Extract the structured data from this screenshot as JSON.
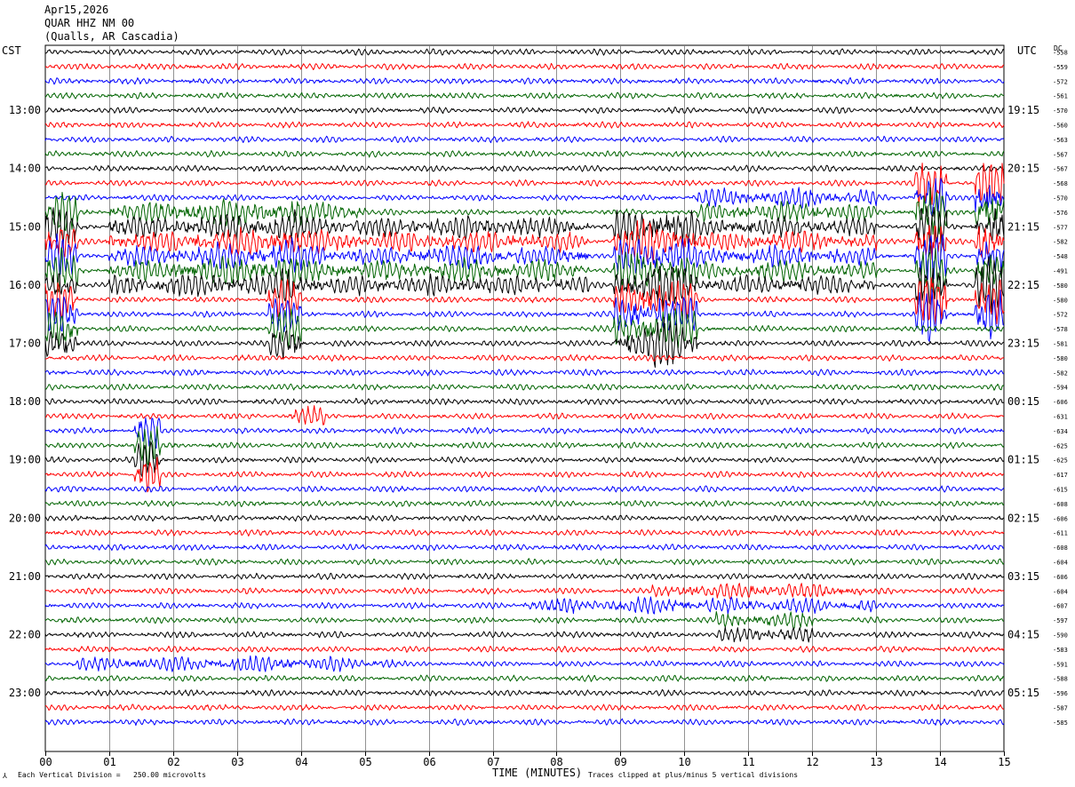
{
  "header": {
    "date": "Apr15,2026",
    "station": "QUAR HHZ NM 00",
    "location": "(Qualls, AR Cascadia)"
  },
  "left_label": "CST",
  "right_label": "UTC",
  "dc_label": "DC",
  "footer": {
    "scale_prefix": "Each Vertical Division =",
    "scale_value": "250.00 microvolts",
    "clip_note": "Traces clipped at plus/minus 5 vertical divisions"
  },
  "chart_data": {
    "type": "line",
    "title": "QUAR HHZ NM 00",
    "xlabel": "TIME (MINUTES)",
    "x_ticks": [
      "00",
      "01",
      "02",
      "03",
      "04",
      "05",
      "06",
      "07",
      "08",
      "09",
      "10",
      "11",
      "12",
      "13",
      "14",
      "15"
    ],
    "xlim": [
      0,
      15
    ],
    "trace_minutes": 15,
    "colors": [
      "#000000",
      "#ff0000",
      "#0000ff",
      "#006400"
    ],
    "left_time_labels": [
      {
        "trace": 4,
        "label": "13:00"
      },
      {
        "trace": 8,
        "label": "14:00"
      },
      {
        "trace": 12,
        "label": "15:00"
      },
      {
        "trace": 16,
        "label": "16:00"
      },
      {
        "trace": 20,
        "label": "17:00"
      },
      {
        "trace": 24,
        "label": "18:00"
      },
      {
        "trace": 28,
        "label": "19:00"
      },
      {
        "trace": 32,
        "label": "20:00"
      },
      {
        "trace": 36,
        "label": "21:00"
      },
      {
        "trace": 40,
        "label": "22:00"
      },
      {
        "trace": 44,
        "label": "23:00"
      }
    ],
    "right_time_labels": [
      {
        "trace": 4,
        "label": "19:15"
      },
      {
        "trace": 8,
        "label": "20:15"
      },
      {
        "trace": 12,
        "label": "21:15"
      },
      {
        "trace": 16,
        "label": "22:15"
      },
      {
        "trace": 20,
        "label": "23:15"
      },
      {
        "trace": 24,
        "label": "00:15"
      },
      {
        "trace": 28,
        "label": "01:15"
      },
      {
        "trace": 32,
        "label": "02:15"
      },
      {
        "trace": 36,
        "label": "03:15"
      },
      {
        "trace": 40,
        "label": "04:15"
      },
      {
        "trace": 44,
        "label": "05:15"
      }
    ],
    "dc_offsets": [
      "-558",
      "-559",
      "-572",
      "-561",
      "-570",
      "-560",
      "-563",
      "-567",
      "-567",
      "-568",
      "-570",
      "-576",
      "-577",
      "-582",
      "-548",
      "-491",
      "-580",
      "-580",
      "-572",
      "-578",
      "-581",
      "-580",
      "-582",
      "-594",
      "-606",
      "-631",
      "-634",
      "-625",
      "-625",
      "-617",
      "-615",
      "-608",
      "-606",
      "-611",
      "-608",
      "-604",
      "-606",
      "-604",
      "-607",
      "-597",
      "-590",
      "-583",
      "-591",
      "-588",
      "-596",
      "-587",
      "-585"
    ],
    "events": [
      {
        "traces": [
          11,
          12,
          13,
          14,
          15,
          16,
          17,
          18,
          19,
          20
        ],
        "start": 0.0,
        "end": 0.5,
        "amp": 1.7
      },
      {
        "traces": [
          12,
          13,
          14,
          15,
          16,
          17,
          18,
          19,
          20
        ],
        "start": 3.5,
        "end": 4.0,
        "amp": 1.5
      },
      {
        "traces": [
          12,
          13,
          14,
          15,
          16,
          17,
          18,
          19,
          20
        ],
        "start": 8.9,
        "end": 10.2,
        "amp": 1.8
      },
      {
        "traces": [
          11,
          12,
          13,
          14,
          15,
          16
        ],
        "start": 1.0,
        "end": 5.0,
        "amp": 0.9
      },
      {
        "traces": [
          12,
          13,
          14,
          15,
          16
        ],
        "start": 5.0,
        "end": 8.5,
        "amp": 0.8
      },
      {
        "traces": [
          10,
          11,
          12,
          13,
          14,
          15,
          16
        ],
        "start": 10.2,
        "end": 13.0,
        "amp": 0.7
      },
      {
        "traces": [
          9,
          10,
          11,
          12,
          13,
          14,
          15,
          16,
          17,
          18
        ],
        "start": 13.6,
        "end": 14.1,
        "amp": 2.2
      },
      {
        "traces": [
          9,
          10,
          11,
          12,
          13,
          14,
          15,
          16,
          17,
          18
        ],
        "start": 14.55,
        "end": 15.0,
        "amp": 2.2
      },
      {
        "traces": [
          26,
          27,
          28,
          29
        ],
        "start": 1.4,
        "end": 1.8,
        "amp": 1.6
      },
      {
        "traces": [
          25
        ],
        "start": 3.8,
        "end": 4.4,
        "amp": 0.7
      },
      {
        "traces": [
          37
        ],
        "start": 9.5,
        "end": 12.8,
        "amp": 0.5
      },
      {
        "traces": [
          38
        ],
        "start": 7.5,
        "end": 13.0,
        "amp": 0.5
      },
      {
        "traces": [
          39,
          40
        ],
        "start": 10.5,
        "end": 12.0,
        "amp": 0.6
      },
      {
        "traces": [
          42
        ],
        "start": 0.5,
        "end": 5.5,
        "amp": 0.45
      }
    ]
  }
}
